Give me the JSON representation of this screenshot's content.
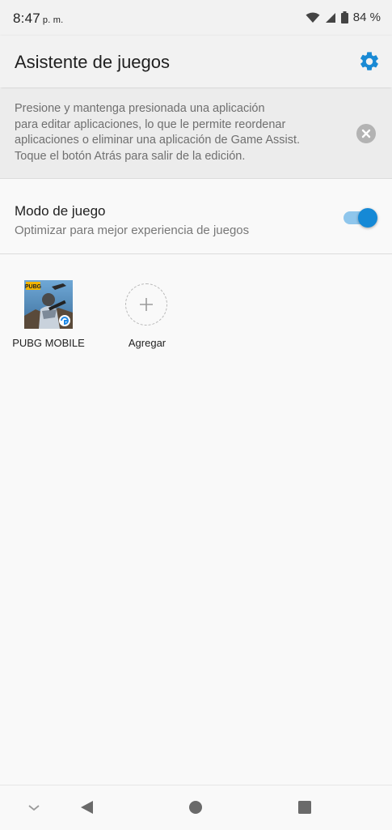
{
  "status_bar": {
    "time": "8:47",
    "ampm": "p. m.",
    "battery_percent": "84 %",
    "icons": [
      "wifi-icon",
      "signal-icon",
      "battery-icon"
    ]
  },
  "app_bar": {
    "title": "Asistente de juegos",
    "settings_icon": "gear-icon",
    "accent_color": "#1a8ad4"
  },
  "info_banner": {
    "lines": [
      "Presione y mantenga presionada una aplicación",
      "para editar aplicaciones, lo que le permite reordenar",
      "aplicaciones o eliminar una aplicación de Game Assist.",
      "Toque el botón Atrás para salir de la edición."
    ],
    "close_icon": "close-icon"
  },
  "game_mode": {
    "title": "Modo de juego",
    "subtitle": "Optimizar para mejor experiencia de juegos",
    "toggle_on": true
  },
  "apps": [
    {
      "label": "PUBG MOBILE",
      "icon": "pubg-mobile-app-icon"
    },
    {
      "label": "Agregar",
      "icon": "add-icon"
    }
  ],
  "nav_bar": {
    "items": [
      "chevron-down-icon",
      "back-icon",
      "home-icon",
      "recents-icon"
    ]
  }
}
